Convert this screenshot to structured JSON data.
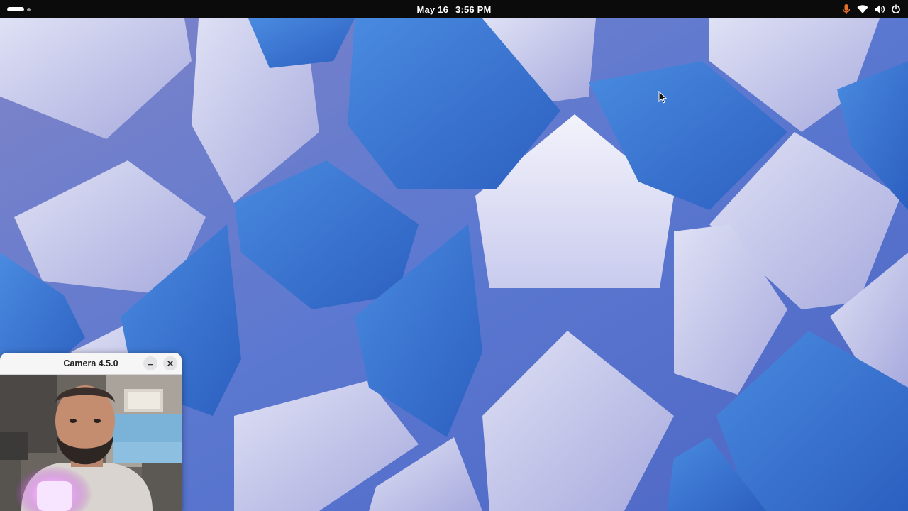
{
  "topbar": {
    "date": "May 16",
    "time": "3:56 PM",
    "icons": {
      "microphone": "microphone-icon",
      "network": "wifi-icon",
      "volume": "volume-icon",
      "power": "power-icon"
    },
    "mic_color": "#e8702a"
  },
  "camera_window": {
    "title": "Camera 4.5.0",
    "minimize_icon": "minimize-icon",
    "close_icon": "close-icon"
  },
  "colors": {
    "topbar_bg": "#0b0b0c",
    "wallpaper_blue": "#3f72cf",
    "wallpaper_lavender": "#b8bde6"
  }
}
